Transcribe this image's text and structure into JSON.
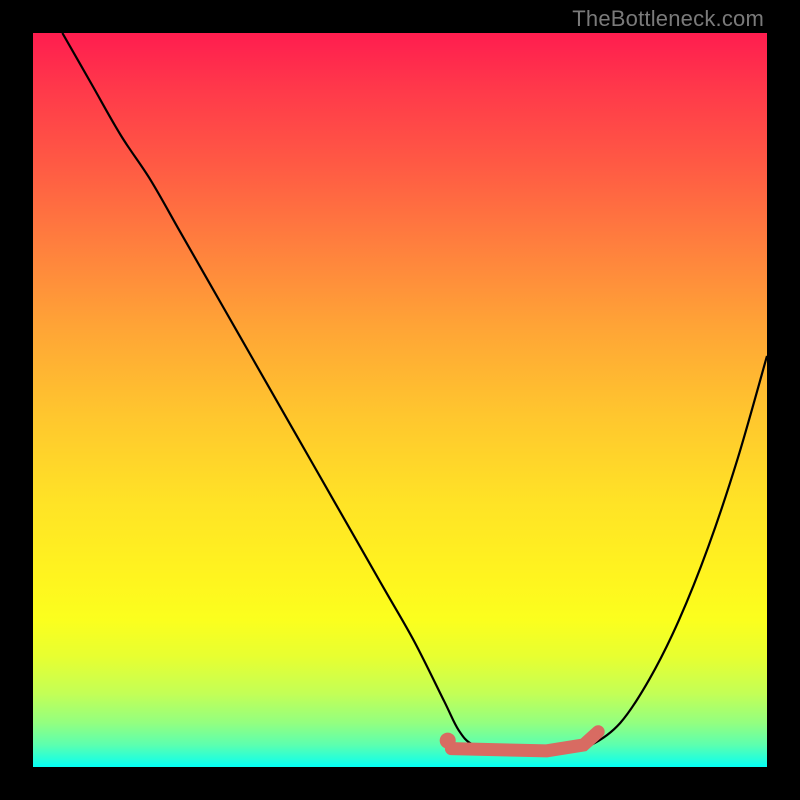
{
  "watermark": "TheBottleneck.com",
  "chart_data": {
    "type": "line",
    "title": "",
    "xlabel": "",
    "ylabel": "",
    "xlim": [
      0,
      100
    ],
    "ylim": [
      0,
      100
    ],
    "grid": false,
    "legend": false,
    "background": "rainbow-gradient-red-to-cyan",
    "series": [
      {
        "name": "bottleneck-curve",
        "color": "#000000",
        "x": [
          4,
          8,
          12,
          16,
          20,
          24,
          28,
          32,
          36,
          40,
          44,
          48,
          52,
          56,
          58,
          60,
          64,
          68,
          72,
          76,
          80,
          84,
          88,
          92,
          96,
          100
        ],
        "y": [
          100,
          93,
          86,
          80,
          73,
          66,
          59,
          52,
          45,
          38,
          31,
          24,
          17,
          9,
          5,
          3,
          2,
          2,
          2,
          3,
          6,
          12,
          20,
          30,
          42,
          56
        ]
      }
    ],
    "annotations": [
      {
        "name": "optimal-range-marker",
        "type": "line-segment",
        "color": "#d86b62",
        "points": [
          {
            "x": 57,
            "y": 2.5
          },
          {
            "x": 70,
            "y": 2.2
          },
          {
            "x": 75,
            "y": 3.0
          },
          {
            "x": 77,
            "y": 4.8
          }
        ]
      },
      {
        "name": "optimal-start-dot",
        "type": "dot",
        "color": "#d86b62",
        "x": 56.5,
        "y": 3.6
      }
    ]
  }
}
